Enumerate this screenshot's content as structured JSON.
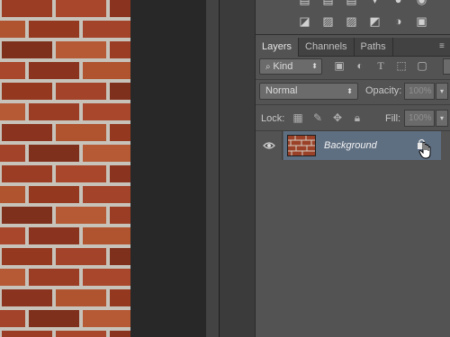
{
  "tabs": [
    {
      "label": "Layers",
      "active": true
    },
    {
      "label": "Channels",
      "active": false
    },
    {
      "label": "Paths",
      "active": false
    }
  ],
  "filter": {
    "kind_label": "Kind",
    "icons": [
      "image-filter-icon",
      "adjustment-filter-icon",
      "type-filter-icon",
      "shape-filter-icon",
      "smart-object-filter-icon"
    ]
  },
  "blend": {
    "mode": "Normal",
    "opacity_label": "Opacity:",
    "opacity_value": "100%"
  },
  "lock": {
    "label": "Lock:",
    "icons": [
      "lock-transparent-icon",
      "lock-image-icon",
      "lock-position-icon",
      "lock-all-icon"
    ],
    "fill_label": "Fill:",
    "fill_value": "100%"
  },
  "layers": [
    {
      "name": "Background",
      "visible": true,
      "locked": true,
      "selected": true
    }
  ],
  "colors": {
    "panel_bg": "#535353",
    "selected_layer": "#5f6f82",
    "canvas_bg": "#282828",
    "brick": "#8e3a22"
  }
}
